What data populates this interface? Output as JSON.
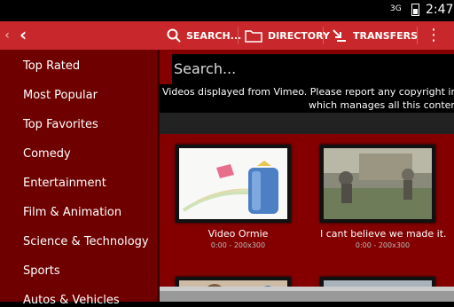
{
  "status": {
    "signal": "3G",
    "time": "2:47"
  },
  "actionbar": {
    "back_icon": "chevron-left-icon",
    "search_label": "SEARCH...",
    "directory_label": "DIRECTORY",
    "transfers_label": "TRANSFERS",
    "accent": "#c8282b"
  },
  "sidebar": {
    "items": [
      {
        "label": "Top Rated"
      },
      {
        "label": "Most Popular"
      },
      {
        "label": "Top Favorites"
      },
      {
        "label": "Comedy"
      },
      {
        "label": "Entertainment"
      },
      {
        "label": "Film & Animation"
      },
      {
        "label": "Science & Technology"
      },
      {
        "label": "Sports"
      },
      {
        "label": "Autos & Vehicles"
      }
    ]
  },
  "search": {
    "placeholder": "Search..."
  },
  "notice": {
    "line1": "Videos displayed from Vimeo. Please report any copyright inf",
    "line2": "which manages all this conten"
  },
  "videos": [
    {
      "title": "Video Ormie",
      "meta": "0:00 - 200x300"
    },
    {
      "title": "I cant believe we made it.",
      "meta": "0:00 - 200x300"
    }
  ]
}
